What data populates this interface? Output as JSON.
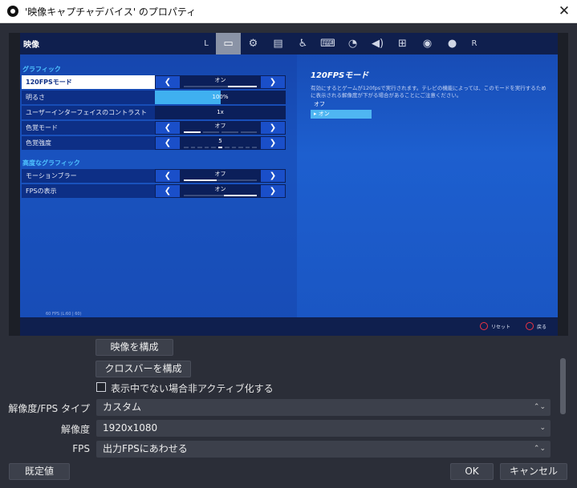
{
  "window": {
    "title": "'映像キャプチャデバイス' のプロパティ",
    "close": "✕"
  },
  "game": {
    "tab_label": "映像",
    "icons": [
      "L1",
      "monitor",
      "gear",
      "display",
      "accessibility",
      "keyboard",
      "controller-alt",
      "audio",
      "network",
      "gamepad",
      "user",
      "R1"
    ],
    "section_graphics": "グラフィック",
    "rows": [
      {
        "name": "120FPSモード",
        "value": "オン",
        "type": "toggle",
        "fill_from": 0.6,
        "fill_to": 1.0,
        "selected": true
      },
      {
        "name": "明るさ",
        "value": "100%",
        "type": "slider",
        "level": 0.5
      },
      {
        "name": "ユーザーインターフェイスのコントラスト",
        "value": "1x",
        "type": "plain"
      },
      {
        "name": "色覚モード",
        "value": "オフ",
        "type": "segments",
        "segments": 4,
        "active": 0
      },
      {
        "name": "色覚強度",
        "value": "5",
        "type": "segments",
        "segments": 11,
        "active": 5
      }
    ],
    "section_advanced": "高度なグラフィック",
    "adv_rows": [
      {
        "name": "モーションブラー",
        "value": "オフ",
        "type": "toggle",
        "fill_from": 0.0,
        "fill_to": 0.45
      },
      {
        "name": "FPSの表示",
        "value": "オン",
        "type": "toggle",
        "fill_from": 0.55,
        "fill_to": 1.0
      }
    ],
    "info_title": "120FPSモード",
    "info_desc": "有効にするとゲームが120fpsで実行されます。テレビの機能によっては、このモードを実行するために表示される解像度が下がる場合があることにご注意ください。",
    "options": [
      "オフ",
      "▸ オン"
    ],
    "fps_readout": "60 FPS (L:60 | 60)",
    "hint_reset": "リセット",
    "hint_back": "戻る"
  },
  "controls": {
    "configure_video": "映像を構成",
    "configure_crossbar": "クロスバーを構成",
    "deactivate_label": "表示中でない場合非アクティブ化する",
    "res_fps_type_label": "解像度/FPS タイプ",
    "res_fps_type_value": "カスタム",
    "resolution_label": "解像度",
    "resolution_value": "1920x1080",
    "fps_label": "FPS",
    "fps_value": "出力FPSにあわせる",
    "defaults": "既定値",
    "ok": "OK",
    "cancel": "キャンセル"
  },
  "colors": {
    "accent": "#4fc3ff",
    "panel": "#0d2f86",
    "background": "#2b2e38"
  }
}
